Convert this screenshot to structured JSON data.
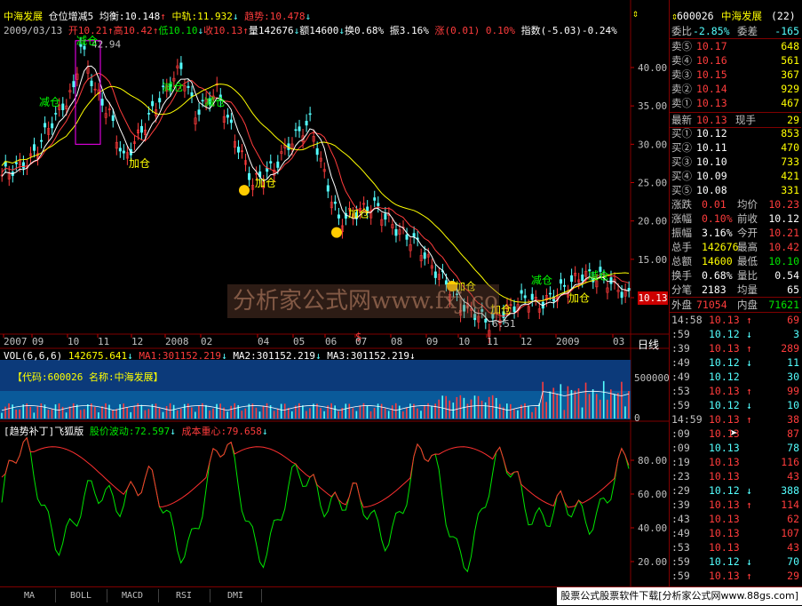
{
  "header": {
    "stock_name": "中海发展",
    "indicator_name": "仓位增减5",
    "avg_label": "均衡:10.148",
    "mid_label": "中轨:11.932",
    "trend_label": "趋势:10.478",
    "date": "2009/03/13",
    "open": "开10.21",
    "high": "高10.42",
    "low": "低10.10",
    "close": "收10.13",
    "volume": "量142676",
    "amount": "额14600",
    "turnover": "换0.68%",
    "amplitude": "振3.16%",
    "change": "涨(0.01) 0.10%",
    "index": "指数(-5.03)-0.24%"
  },
  "price_axis": [
    "40.00",
    "35.00",
    "30.00",
    "25.00",
    "20.00",
    "15.00",
    "10.00"
  ],
  "price_marker": "10.13",
  "annotations": {
    "high_label": "42.94",
    "low_label": "6.51",
    "reduce": "减仓",
    "add": "加仓"
  },
  "time_axis": {
    "labels": [
      "2007",
      "09",
      "10",
      "11",
      "12",
      "2008",
      "02",
      "04",
      "05",
      "06",
      "07",
      "08",
      "09",
      "10",
      "11",
      "12",
      "2009",
      "03"
    ],
    "period": "日线"
  },
  "volume_panel": {
    "header_vol": "VOL(6,6,6)",
    "vol_value": "142675.641",
    "ma1": "MA1:301152.219",
    "ma2": "MA2:301152.219",
    "ma3": "MA3:301152.219",
    "code_info": "【代码:600026 名称:中海发展】",
    "axis": [
      "500000",
      "0"
    ]
  },
  "osc_panel": {
    "title": "[趋势补丁]飞狐版",
    "wave_label": "股价波动:72.597",
    "cost_label": "成本重心:79.658",
    "axis": [
      "80.00",
      "60.00",
      "40.00",
      "20.00"
    ]
  },
  "watermark": "分析家公式网www.fxj.com",
  "sidebar": {
    "code": "600026",
    "name": "中海发展",
    "num": "(22)",
    "weibi_label": "委比",
    "weibi_val": "-2.85%",
    "weicha_label": "委差",
    "weicha_val": "-165",
    "sells": [
      {
        "label": "卖⑤",
        "price": "10.17",
        "vol": "648"
      },
      {
        "label": "卖④",
        "price": "10.16",
        "vol": "561"
      },
      {
        "label": "卖③",
        "price": "10.15",
        "vol": "367"
      },
      {
        "label": "卖②",
        "price": "10.14",
        "vol": "929"
      },
      {
        "label": "卖①",
        "price": "10.13",
        "vol": "467"
      }
    ],
    "latest_label": "最新",
    "latest_val": "10.13",
    "xianshou_label": "现手",
    "xianshou_val": "29",
    "buys": [
      {
        "label": "买①",
        "price": "10.12",
        "vol": "853"
      },
      {
        "label": "买②",
        "price": "10.11",
        "vol": "470"
      },
      {
        "label": "买③",
        "price": "10.10",
        "vol": "733"
      },
      {
        "label": "买④",
        "price": "10.09",
        "vol": "421"
      },
      {
        "label": "买⑤",
        "price": "10.08",
        "vol": "331"
      }
    ],
    "stats": [
      {
        "l1": "涨跌",
        "v1": "0.01",
        "l2": "均价",
        "v2": "10.23",
        "c1": "red",
        "c2": "red"
      },
      {
        "l1": "涨幅",
        "v1": "0.10%",
        "l2": "前收",
        "v2": "10.12",
        "c1": "red",
        "c2": "wht"
      },
      {
        "l1": "振幅",
        "v1": "3.16%",
        "l2": "今开",
        "v2": "10.21",
        "c1": "wht",
        "c2": "red"
      },
      {
        "l1": "总手",
        "v1": "142676",
        "l2": "最高",
        "v2": "10.42",
        "c1": "yel",
        "c2": "red"
      },
      {
        "l1": "总额",
        "v1": "14600",
        "l2": "最低",
        "v2": "10.10",
        "c1": "yel",
        "c2": "grn"
      },
      {
        "l1": "换手",
        "v1": "0.68%",
        "l2": "量比",
        "v2": "0.54",
        "c1": "wht",
        "c2": "wht"
      },
      {
        "l1": "分笔",
        "v1": "2183",
        "l2": "均量",
        "v2": "65",
        "c1": "wht",
        "c2": "wht"
      }
    ],
    "waipan_label": "外盘",
    "waipan_val": "71054",
    "neipan_label": "内盘",
    "neipan_val": "71621",
    "ticks": [
      {
        "t": "14:58",
        "p": "10.13",
        "d": "↑",
        "v": "69",
        "c": "red"
      },
      {
        "t": ":59",
        "p": "10.12",
        "d": "↓",
        "v": "3",
        "c": "cyan"
      },
      {
        "t": ":39",
        "p": "10.13",
        "d": "↑",
        "v": "289",
        "c": "red"
      },
      {
        "t": ":49",
        "p": "10.12",
        "d": "↓",
        "v": "11",
        "c": "cyan"
      },
      {
        "t": ":49",
        "p": "10.12",
        "d": "",
        "v": "30",
        "c": "cyan"
      },
      {
        "t": ":53",
        "p": "10.13",
        "d": "↑",
        "v": "99",
        "c": "red"
      },
      {
        "t": ":59",
        "p": "10.12",
        "d": "↓",
        "v": "10",
        "c": "cyan"
      },
      {
        "t": "14:59",
        "p": "10.13",
        "d": "↑",
        "v": "38",
        "c": "red"
      },
      {
        "t": ":09",
        "p": "10.13",
        "d": "",
        "v": "87",
        "c": "red"
      },
      {
        "t": ":09",
        "p": "10.13",
        "d": "",
        "v": "78",
        "c": "cyan"
      },
      {
        "t": ":19",
        "p": "10.13",
        "d": "",
        "v": "116",
        "c": "red"
      },
      {
        "t": ":23",
        "p": "10.13",
        "d": "",
        "v": "43",
        "c": "red"
      },
      {
        "t": ":29",
        "p": "10.12",
        "d": "↓",
        "v": "388",
        "c": "cyan"
      },
      {
        "t": ":39",
        "p": "10.13",
        "d": "↑",
        "v": "114",
        "c": "red"
      },
      {
        "t": ":43",
        "p": "10.13",
        "d": "",
        "v": "62",
        "c": "red"
      },
      {
        "t": ":49",
        "p": "10.13",
        "d": "",
        "v": "107",
        "c": "red"
      },
      {
        "t": ":53",
        "p": "10.13",
        "d": "",
        "v": "43",
        "c": "red"
      },
      {
        "t": ":59",
        "p": "10.12",
        "d": "↓",
        "v": "70",
        "c": "cyan"
      },
      {
        "t": ":59",
        "p": "10.13",
        "d": "↑",
        "v": "29",
        "c": "red"
      }
    ]
  },
  "bottom_tabs": [
    "MA",
    "BOLL",
    "MACD",
    "RSI",
    "DMI"
  ],
  "ad_banner": "股票公式股票软件下载[分析家公式网www.88gs.com]"
}
